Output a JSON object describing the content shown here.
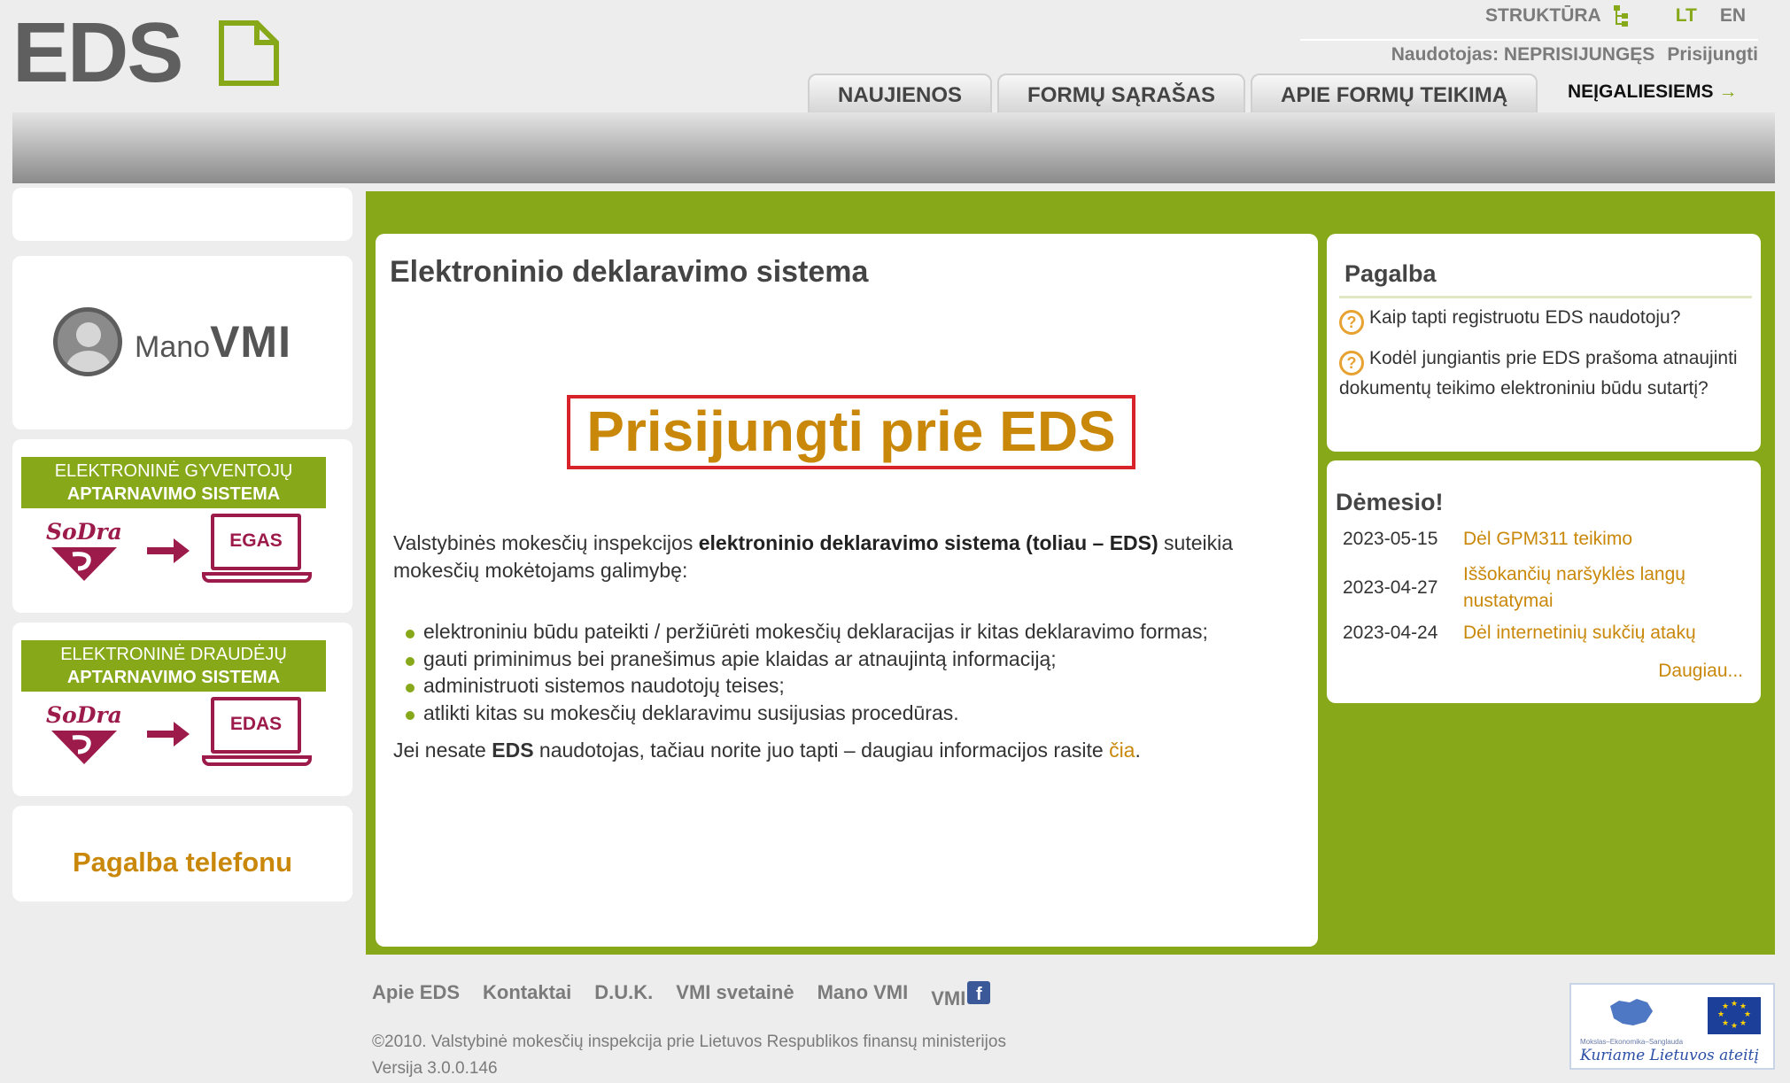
{
  "header": {
    "logo_text": "EDS",
    "structure_link": "STRUKTŪRA",
    "lang_lt": "LT",
    "lang_en": "EN",
    "user_label": "Naudotojas: NEPRISIJUNGĘS",
    "login_link": "Prisijungti",
    "tabs": [
      "NAUJIENOS",
      "FORMŲ SĄRAŠAS",
      "APIE FORMŲ TEIKIMĄ"
    ],
    "accessibility_link": "NEĮGALIESIEMS",
    "accessibility_arrow": "→"
  },
  "sidebar": {
    "mano_vmi": {
      "mano": "Mano",
      "vmi": "VMI"
    },
    "egas": {
      "line1": "ELEKTRONINĖ GYVENTOJŲ",
      "line2": "APTARNAVIMO SISTEMA",
      "sodra": "SoDra",
      "screen": "EGAS"
    },
    "edas": {
      "line1": "ELEKTRONINĖ DRAUDĖJŲ",
      "line2": "APTARNAVIMO SISTEMA",
      "sodra": "SoDra",
      "screen": "EDAS"
    },
    "phone_help": "Pagalba telefonu"
  },
  "main": {
    "title": "Elektroninio deklaravimo sistema",
    "login_button": "Prisijungti prie EDS",
    "intro_pre": "Valstybinės mokesčių inspekcijos ",
    "intro_bold": "elektroninio deklaravimo sistema (toliau – EDS)",
    "intro_post": " suteikia mokesčių mokėtojams galimybę:",
    "bullets": [
      "elektroniniu būdu pateikti / peržiūrėti mokesčių deklaracijas ir kitas deklaravimo formas;",
      "gauti priminimus bei pranešimus apie klaidas ar atnaujintą informaciją;",
      "administruoti sistemos naudotojų teises;",
      "atlikti kitas su mokesčių deklaravimu susijusias procedūras."
    ],
    "outro_pre": "Jei nesate ",
    "outro_bold": "EDS",
    "outro_mid": " naudotojas, tačiau norite juo tapti – daugiau informacijos rasite ",
    "outro_link": "čia",
    "outro_post": "."
  },
  "help": {
    "title": "Pagalba",
    "questions": [
      "Kaip tapti registruotu EDS naudotoju?",
      "Kodėl jungiantis prie EDS prašoma atnaujinti dokumentų teikimo elektroniniu būdu sutartį?"
    ]
  },
  "attention": {
    "title": "Dėmesio!",
    "news": [
      {
        "date": "2023-05-15",
        "text": "Dėl GPM311 teikimo"
      },
      {
        "date": "2023-04-27",
        "text": "Iššokančių naršyklės langų nustatymai"
      },
      {
        "date": "2023-04-24",
        "text": "Dėl internetinių sukčių atakų"
      }
    ],
    "more": "Daugiau..."
  },
  "footer": {
    "links": [
      "Apie EDS",
      "Kontaktai",
      "D.U.K.",
      "VMI svetainė",
      "Mano VMI",
      "VMI"
    ],
    "copyright": "©2010. Valstybinė mokesčių inspekcija prie Lietuvos Respublikos finansų ministerijos",
    "version": "Versija 3.0.0.146",
    "eu_small": "Mokslas–Ekonomika–Sanglauda",
    "eu_motto": "Kuriame Lietuvos ateitį"
  },
  "colors": {
    "brand_green": "#86a819",
    "link_gold": "#c9880a",
    "highlight_red": "#d8232a",
    "sodra": "#9d1b4a"
  }
}
